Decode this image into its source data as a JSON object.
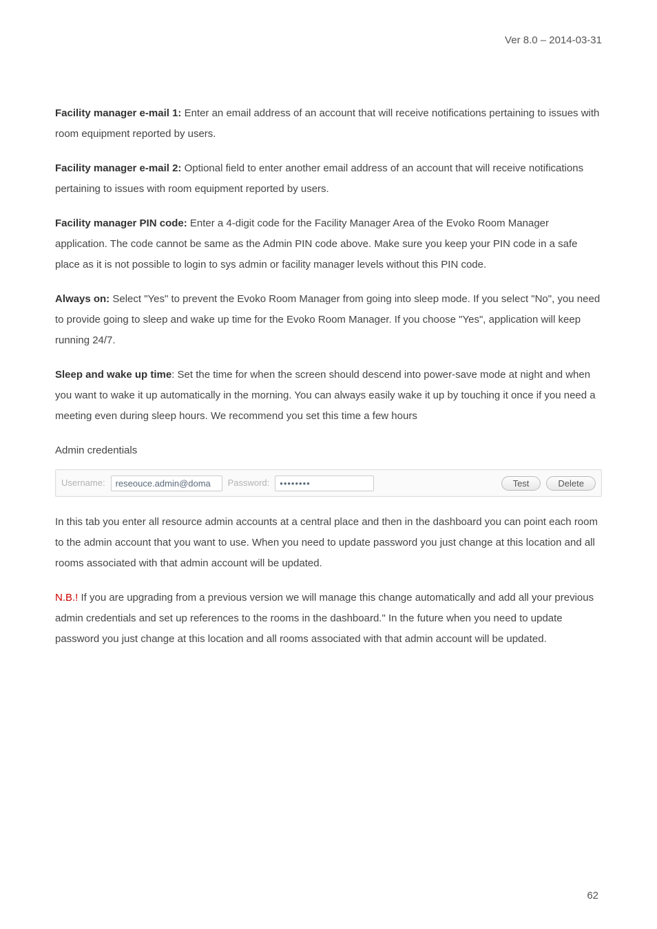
{
  "header": {
    "version": "Ver 8.0 – 2014-03-31"
  },
  "sections": {
    "fm_email1_label": "Facility manager e-mail 1:",
    "fm_email1_text": " Enter an email address of an account that will receive notifications pertaining to issues with room equipment reported by users.",
    "fm_email2_label": "Facility manager e-mail 2:",
    "fm_email2_text": " Optional field to enter another email address of an account that will receive notifications pertaining to issues with room equipment reported by users.",
    "fm_pin_label": "Facility manager PIN code:",
    "fm_pin_text": " Enter a 4-digit code for the Facility Manager Area of the Evoko Room Manager application. The code cannot be same as the Admin PIN code above. Make sure you keep your PIN code in a safe place as it is not possible to login to sys admin or facility manager levels without this PIN code.",
    "always_on_label": "Always on:",
    "always_on_text": " Select \"Yes\" to prevent the Evoko Room Manager from going into sleep mode. If you select \"No\", you need to provide going to sleep and wake up time for the Evoko Room Manager. If you choose \"Yes\", application will keep running 24/7.",
    "sleep_label": "Sleep and wake up time",
    "sleep_text": ": Set the time for when the screen should descend into power-save mode at night and when you want to wake it up automatically in the morning. You can always easily wake it up by touching it once if you need a meeting even during sleep hours. We recommend you set this time a few hours",
    "admin_cred_heading": "Admin credentials"
  },
  "cred_row": {
    "username_label": "Username:",
    "username_value": "reseouce.admin@doma",
    "password_label": "Password:",
    "password_value": "••••••••",
    "test_button": "Test",
    "delete_button": "Delete"
  },
  "after": {
    "para1": "In this tab you enter all resource admin accounts at a central place and then in the dashboard you can point each room to the admin account that you want to use. When you need to update password you just change at this location and all rooms associated with that admin account will be updated.",
    "nb_label": "N.B.!",
    "nb_text": " If you are upgrading from a previous version we will manage this change automatically and add all your previous admin credentials and set up references to the rooms in the dashboard.\" In the future when you need to update password you just change at this location and all rooms associated with that admin account will be updated."
  },
  "page_number": "62"
}
